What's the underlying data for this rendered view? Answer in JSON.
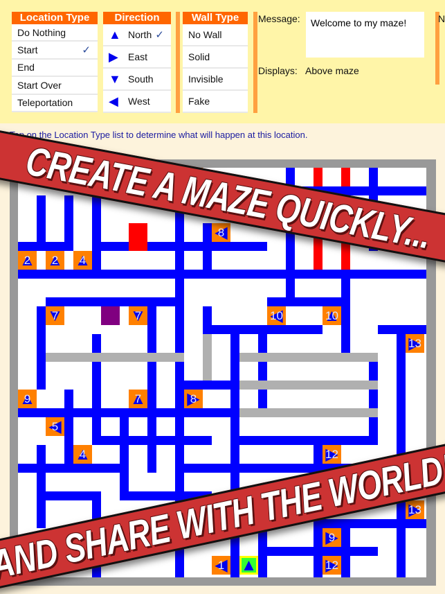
{
  "panel": {
    "location_type": {
      "title": "Location Type",
      "items": [
        "Do Nothing",
        "Start",
        "End",
        "Start Over",
        "Teleportation"
      ],
      "selected": "Start"
    },
    "direction": {
      "title": "Direction",
      "items": [
        {
          "label": "North",
          "icon": "arrow-up-icon",
          "glyph": "▲"
        },
        {
          "label": "East",
          "icon": "arrow-right-icon",
          "glyph": "▶"
        },
        {
          "label": "South",
          "icon": "arrow-down-icon",
          "glyph": "▼"
        },
        {
          "label": "West",
          "icon": "arrow-left-icon",
          "glyph": "◀"
        }
      ],
      "selected": "North"
    },
    "wall_type": {
      "title": "Wall Type",
      "items": [
        "No Wall",
        "Solid",
        "Invisible",
        "Fake"
      ]
    },
    "message_label": "Message:",
    "message_value": "Welcome to my maze!",
    "displays_label": "Displays:",
    "displays_value": "Above maze",
    "cut_label": "N",
    "check": "✓"
  },
  "hint": "Tap on the Location Type list to determine what will happen at this location.",
  "banners": {
    "top": "CREATE A MAZE QUICKLY...",
    "bottom": "AND SHARE WITH THE WORLD!"
  },
  "colors": {
    "header": "#ff6600",
    "wall_solid": "#0000ff",
    "wall_invisible": "#b0b0b0",
    "wall_fake": "#ff0000",
    "marker": "#ff8000",
    "start": "#33ff33"
  },
  "maze_markers": [
    {
      "col": 0,
      "row": 3,
      "label": "2",
      "dir": "N"
    },
    {
      "col": 1,
      "row": 3,
      "label": "2",
      "dir": "N"
    },
    {
      "col": 2,
      "row": 3,
      "label": "4",
      "dir": "N"
    },
    {
      "col": 7,
      "row": 2,
      "label": "8",
      "dir": "W"
    },
    {
      "col": 6,
      "row": 0,
      "label": "",
      "dir": "E"
    },
    {
      "col": 1,
      "row": 5,
      "label": "7",
      "dir": "S"
    },
    {
      "col": 4,
      "row": 5,
      "label": "7",
      "dir": "S"
    },
    {
      "col": 9,
      "row": 5,
      "label": "10",
      "dir": "W"
    },
    {
      "col": 11,
      "row": 5,
      "label": "10",
      "dir": "N"
    },
    {
      "col": 14,
      "row": 6,
      "label": "13",
      "dir": "E"
    },
    {
      "col": 0,
      "row": 8,
      "label": "9",
      "dir": "N"
    },
    {
      "col": 4,
      "row": 8,
      "label": "7",
      "dir": "N"
    },
    {
      "col": 6,
      "row": 8,
      "label": "8",
      "dir": "E"
    },
    {
      "col": 1,
      "row": 9,
      "label": "5",
      "dir": "W"
    },
    {
      "col": 2,
      "row": 10,
      "label": "4",
      "dir": "N"
    },
    {
      "col": 11,
      "row": 10,
      "label": "12",
      "dir": "E"
    },
    {
      "col": 14,
      "row": 12,
      "label": "13",
      "dir": "E"
    },
    {
      "col": 11,
      "row": 13,
      "label": "9",
      "dir": "E"
    },
    {
      "col": 7,
      "row": 14,
      "label": "1",
      "dir": "W"
    },
    {
      "col": 8,
      "row": 14,
      "label": "",
      "dir": "N",
      "start": true
    },
    {
      "col": 11,
      "row": 14,
      "label": "12",
      "dir": "E"
    }
  ]
}
